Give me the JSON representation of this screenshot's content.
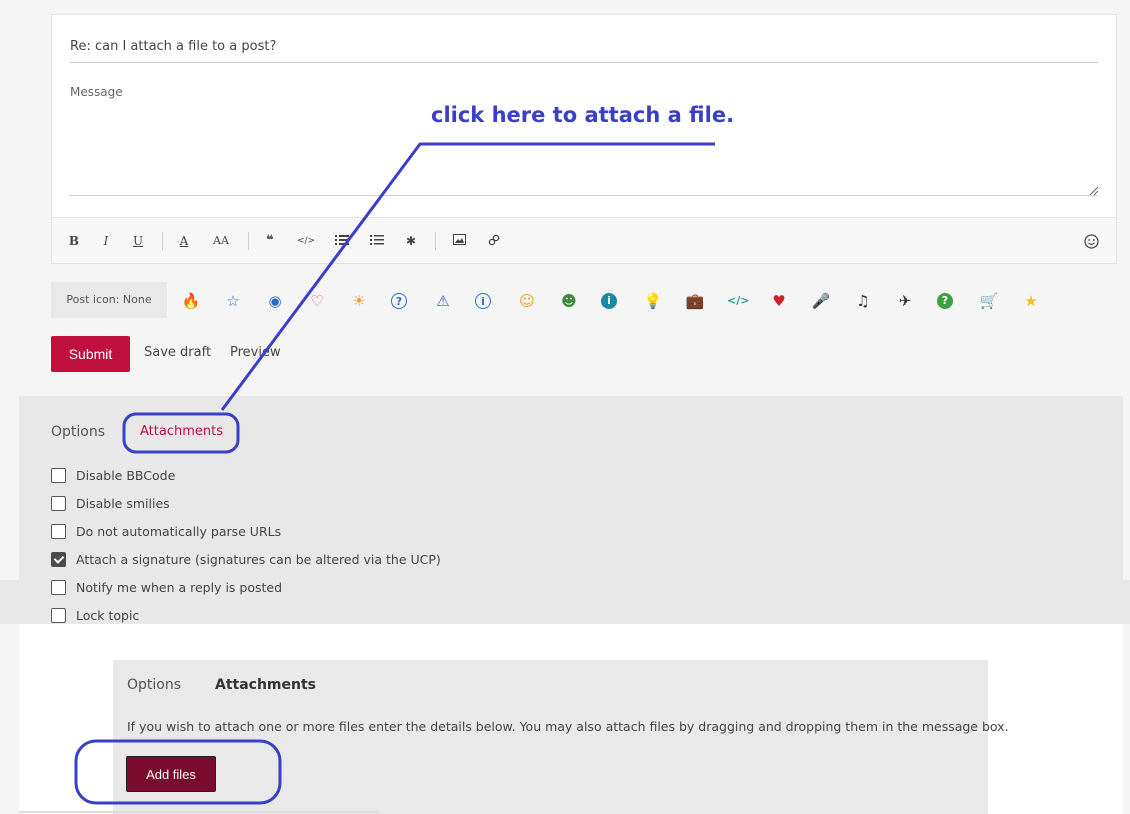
{
  "composer": {
    "subject": "Re: can I attach a file to a post?",
    "message_placeholder": "Message",
    "toolbar": {
      "bold": "B",
      "italic": "I",
      "underline": "U",
      "font_color": "A",
      "font_size": "AA",
      "quote": "❝",
      "code": "</>",
      "list_bulleted": "list-icon",
      "list_numbered": "numbered-list-icon",
      "list_item": "✱",
      "image": "image-icon",
      "link": "link-icon",
      "emoji": "smiley-icon"
    }
  },
  "post_icons": {
    "label": "Post icon: None",
    "icons": [
      {
        "name": "fire-icon",
        "glyph": "🔥",
        "color": "#e8833a"
      },
      {
        "name": "star-outline-icon",
        "glyph": "☆",
        "color": "#2b6cc4"
      },
      {
        "name": "alien-icon",
        "glyph": "◉",
        "color": "#2b6cc4"
      },
      {
        "name": "heart-outline-icon",
        "glyph": "♡",
        "color": "#e0507a"
      },
      {
        "name": "sun-idea-icon",
        "glyph": "☀",
        "color": "#e8a020"
      },
      {
        "name": "question-circle-icon",
        "glyph": "?",
        "color": "#2b6cc4"
      },
      {
        "name": "warning-icon",
        "glyph": "⚠",
        "color": "#2b6cc4"
      },
      {
        "name": "info-circle-icon",
        "glyph": "i",
        "color": "#2b6cc4"
      },
      {
        "name": "smiley-wink-icon",
        "glyph": "☺",
        "color": "#e8a020"
      },
      {
        "name": "grin-icon",
        "glyph": "☻",
        "color": "#3a8a3a"
      },
      {
        "name": "info-solid-icon",
        "glyph": "i",
        "color": "#1a8aa0"
      },
      {
        "name": "lightbulb-icon",
        "glyph": "💡",
        "color": "#f0c020"
      },
      {
        "name": "briefcase-icon",
        "glyph": "💼",
        "color": "#6b4423"
      },
      {
        "name": "code-icon",
        "glyph": "</>",
        "color": "#20a090"
      },
      {
        "name": "heart-icon",
        "glyph": "♥",
        "color": "#d0202a"
      },
      {
        "name": "microphone-icon",
        "glyph": "🎤",
        "color": "#2a9a6a"
      },
      {
        "name": "music-note-icon",
        "glyph": "♫",
        "color": "#333333"
      },
      {
        "name": "airplane-icon",
        "glyph": "✈",
        "color": "#333333"
      },
      {
        "name": "question-solid-icon",
        "glyph": "?",
        "color": "#3aa040"
      },
      {
        "name": "cart-icon",
        "glyph": "🛒",
        "color": "#6b4423"
      },
      {
        "name": "star-icon",
        "glyph": "★",
        "color": "#f0c020"
      }
    ]
  },
  "actions": {
    "submit": "Submit",
    "save_draft": "Save draft",
    "preview": "Preview"
  },
  "options_panel": {
    "tab_options": "Options",
    "tab_attachments": "Attachments",
    "options": [
      {
        "label": "Disable BBCode",
        "checked": false
      },
      {
        "label": "Disable smilies",
        "checked": false
      },
      {
        "label": "Do not automatically parse URLs",
        "checked": false
      },
      {
        "label": "Attach a signature (signatures can be altered via the UCP)",
        "checked": true
      },
      {
        "label": "Notify me when a reply is posted",
        "checked": false
      },
      {
        "label": "Lock topic",
        "checked": false
      }
    ]
  },
  "attachments_panel": {
    "tab_options": "Options",
    "tab_attachments": "Attachments",
    "help_text": "If you wish to attach one or more files enter the details below. You may also attach files by dragging and dropping them in the message box.",
    "add_files": "Add files"
  },
  "annotation": {
    "text": "click here to attach a file.",
    "color": "#3a3fc8"
  },
  "colors": {
    "accent": "#c0103f",
    "add_files_bg": "#7a0a2e"
  }
}
